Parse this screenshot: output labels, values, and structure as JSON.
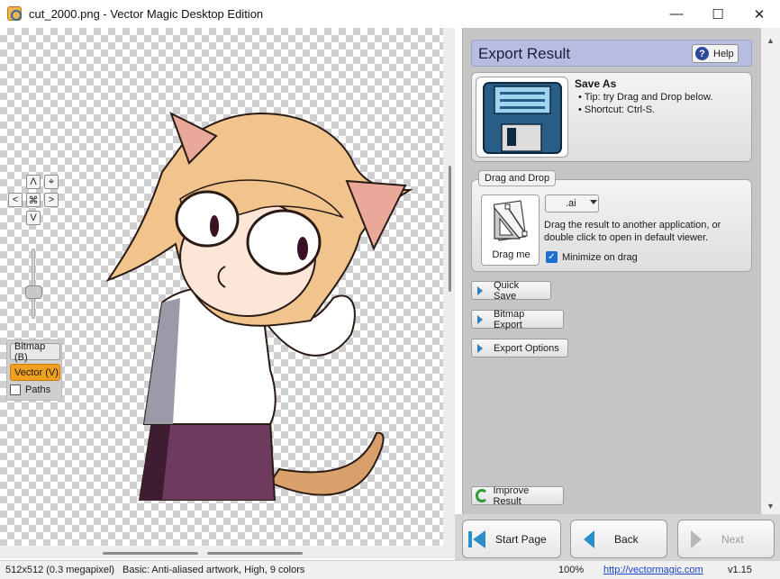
{
  "window": {
    "title": "cut_2000.png - Vector Magic Desktop Edition",
    "minimize": "—",
    "maximize": "☐",
    "close": "✕"
  },
  "nav_pad": {
    "up": "Λ",
    "left": "<",
    "right": ">",
    "down": "V",
    "fit": "⌘",
    "center": "⌖"
  },
  "view_modes": {
    "bitmap": "Bitmap (B)",
    "vector": "Vector (V)",
    "paths": "Paths",
    "active": "vector",
    "paths_checked": false
  },
  "panel": {
    "title": "Export Result",
    "help_label": "Help",
    "help_icon": "?",
    "save_as": {
      "title": "Save As",
      "tips": [
        "Tip: try Drag and Drop below.",
        "Shortcut: Ctrl-S."
      ]
    },
    "drag_drop": {
      "label": "Drag and Drop",
      "drag_me": "Drag me",
      "format": ".ai",
      "description": "Drag the result to another application, or double click to open in default viewer.",
      "minimize_label": "Minimize on drag",
      "minimize_checked": true,
      "check_mark": "✓"
    },
    "actions": {
      "quick_save": "Quick Save",
      "bitmap_export": "Bitmap Export",
      "export_options": "Export Options",
      "improve_result": "Improve Result"
    }
  },
  "wizard": {
    "start_page": "Start Page",
    "back": "Back",
    "next": "Next"
  },
  "status": {
    "size": "512x512 (0.3 megapixel)",
    "settings": "Basic: Anti-aliased artwork, High, 9 colors",
    "zoom": "100%",
    "url": "http://vectormagic.com",
    "version": "v1.15"
  },
  "colors": {
    "accent_active": "#f0a01e",
    "header_bg": "#b7bde0",
    "link": "#1a45c8",
    "nav_blue": "#2a8ec9"
  }
}
